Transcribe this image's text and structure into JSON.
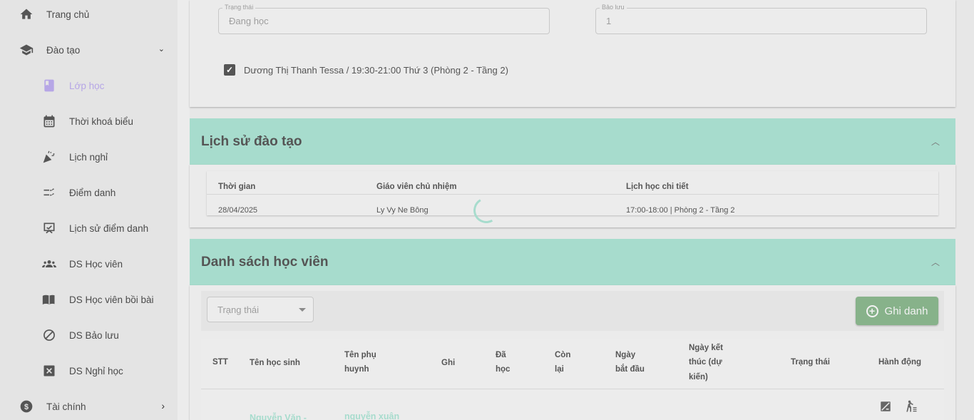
{
  "sidebar": {
    "items": [
      {
        "label": "Trang chủ",
        "icon": "home-icon"
      },
      {
        "label": "Đào tạo",
        "icon": "graduation-cap-icon",
        "arrow": "⌄"
      },
      {
        "label": "Lớp học",
        "icon": "book-icon"
      },
      {
        "label": "Thời khoá biểu",
        "icon": "calendar-icon"
      },
      {
        "label": "Lịch nghỉ",
        "icon": "party-popper-icon"
      },
      {
        "label": "Điểm danh",
        "icon": "checklist-icon"
      },
      {
        "label": "Lịch sử điểm danh",
        "icon": "attendance-history-icon"
      },
      {
        "label": "DS Học viên",
        "icon": "groups-icon"
      },
      {
        "label": "DS Học viên bồi bài",
        "icon": "open-book-icon"
      },
      {
        "label": "DS Bảo lưu",
        "icon": "block-icon"
      },
      {
        "label": "DS Nghỉ học",
        "icon": "x-box-icon"
      },
      {
        "label": "Tài chính",
        "icon": "dollar-circle-icon",
        "arrow": "›"
      }
    ],
    "active_color": "#b6a6e6"
  },
  "top_card": {
    "status_field": {
      "label": "Trạng thái",
      "value": "Đang học"
    },
    "reserve_field": {
      "label": "Bảo lưu",
      "value": "1"
    },
    "checkbox_label": "Dương Thị Thanh Tessa / 19:30-21:00 Thứ 3 (Phòng 2 - Tầng 2)",
    "checkbox_checked": true
  },
  "history": {
    "title": "Lịch sử đào tạo",
    "columns": [
      "Thời gian",
      "Giáo viên chủ nhiệm",
      "Lịch học chi tiết"
    ],
    "rows": [
      [
        "28/04/2025",
        "Ly Vy Ne Bông",
        "17:00-18:00 | Phòng 2 - Tầng 2"
      ]
    ]
  },
  "students": {
    "title": "Danh sách học viên",
    "filter_placeholder": "Trạng thái",
    "enroll_label": "Ghi danh",
    "columns": {
      "stt": "STT",
      "name": "Tên học sinh",
      "parent_1": "Tên phụ",
      "parent_2": "huynh",
      "note": "Ghi",
      "done_1": "Đã",
      "done_2": "học",
      "remain_1": "Còn",
      "remain_2": "lại",
      "start_1": "Ngày",
      "start_2": "bắt đầu",
      "end_1": "Ngày kết",
      "end_2": "thúc (dự",
      "end_3": "kiến)",
      "status": "Trạng thái",
      "action": "Hành động"
    },
    "rows": [
      {
        "name": "Nguyễn Văn -",
        "parent": "nguyễn xuân"
      }
    ]
  },
  "colors": {
    "section_header": "#a7dccd",
    "enroll_button": "#87b28a"
  }
}
